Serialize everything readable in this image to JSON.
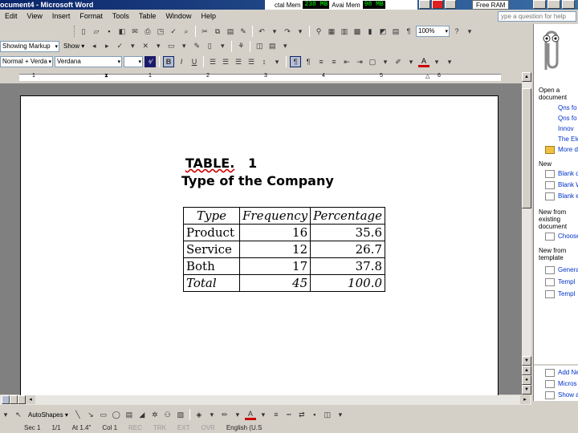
{
  "window": {
    "title": "ocument4 - Microsoft Word",
    "mem_label_total": "ctal Mem",
    "mem_total": "238 MB",
    "mem_label_avail": "Avai Mem",
    "mem_avail": "98 MB",
    "free_ram": "Free RAM"
  },
  "menu": {
    "items": [
      "Edit",
      "View",
      "Insert",
      "Format",
      "Tools",
      "Table",
      "Window",
      "Help"
    ],
    "help_placeholder": "ype a question for help"
  },
  "toolbar": {
    "zoom": "100%",
    "showing_markup": "Showing Markup",
    "show": "Show",
    "style": "Normal + Verda",
    "font": "Verdana",
    "bold": "B",
    "italic": "I",
    "underline": "U",
    "font_color_letter": "A"
  },
  "ruler": {
    "numbers": [
      "1",
      "1",
      "2",
      "3",
      "4",
      "5",
      "6"
    ]
  },
  "document": {
    "table_label": "TABLE.",
    "table_number": "1",
    "table_title": "Type of the Company",
    "columns": [
      "Type",
      "Frequency",
      "Percentage"
    ],
    "rows": [
      {
        "type": "Product",
        "frequency": "16",
        "percentage": "35.6"
      },
      {
        "type": "Service",
        "frequency": "12",
        "percentage": "26.7"
      },
      {
        "type": "Both",
        "frequency": "17",
        "percentage": "37.8"
      }
    ],
    "total": {
      "type": "Total",
      "frequency": "45",
      "percentage": "100.0"
    }
  },
  "drawing": {
    "autoshapes": "AutoShapes"
  },
  "status": {
    "page": "Sec 1",
    "pos": "1/1",
    "at": "At 1.4\"",
    "col": "Col 1",
    "rec": "REC",
    "trk": "TRK",
    "ext": "EXT",
    "ovr": "OVR",
    "lang": "English (U.S"
  },
  "taskpane": {
    "open_doc": "Open a document",
    "open_links": [
      "Qns fo",
      "Qns fo",
      "Innov",
      "The Ele"
    ],
    "more_docs": "More d",
    "new_label": "New",
    "new_links": [
      "Blank d",
      "Blank W",
      "Blank e"
    ],
    "new_from_existing": "New from existing document",
    "choose": "Choose",
    "new_from_template": "New from template",
    "template_links": [
      "Genera",
      "Templ",
      "Templ"
    ],
    "bottom_links": [
      "Add Ne",
      "Micros",
      "Show a"
    ]
  }
}
